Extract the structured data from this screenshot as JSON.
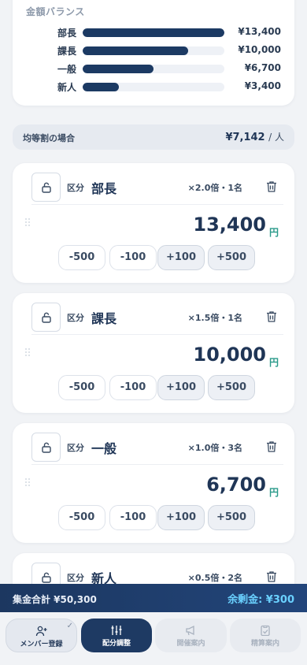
{
  "balance": {
    "title": "金額バランス",
    "rows": [
      {
        "label": "部長",
        "value": "¥13,400",
        "ratio": 1.0
      },
      {
        "label": "課長",
        "value": "¥10,000",
        "ratio": 0.746
      },
      {
        "label": "一般",
        "value": "¥6,700",
        "ratio": 0.5
      },
      {
        "label": "新人",
        "value": "¥3,400",
        "ratio": 0.254
      }
    ]
  },
  "equal_split": {
    "label": "均等割の場合",
    "value": "¥7,142",
    "unit": "/ 人"
  },
  "members": [
    {
      "kubun": "区分",
      "name": "部長",
      "multiplier": "×2.0倍・1名",
      "amount": "13,400",
      "currency": "円",
      "buttons": [
        "-500",
        "-100",
        "+100",
        "+500"
      ]
    },
    {
      "kubun": "区分",
      "name": "課長",
      "multiplier": "×1.5倍・1名",
      "amount": "10,000",
      "currency": "円",
      "buttons": [
        "-500",
        "-100",
        "+100",
        "+500"
      ]
    },
    {
      "kubun": "区分",
      "name": "一般",
      "multiplier": "×1.0倍・3名",
      "amount": "6,700",
      "currency": "円",
      "buttons": [
        "-500",
        "-100",
        "+100",
        "+500"
      ]
    },
    {
      "kubun": "区分",
      "name": "新人",
      "multiplier": "×0.5倍・2名",
      "amount": "",
      "currency": "",
      "buttons": []
    }
  ],
  "footer": {
    "total": "集金合計 ¥50,300",
    "remainder": "余剰金: ¥300"
  },
  "nav": [
    {
      "label": "メンバー登録",
      "icon": "user-plus-icon",
      "state": "done"
    },
    {
      "label": "配分調整",
      "icon": "sliders-icon",
      "state": "active"
    },
    {
      "label": "開催案内",
      "icon": "megaphone-icon",
      "state": "disabled"
    },
    {
      "label": "精算案内",
      "icon": "clipboard-check-icon",
      "state": "disabled"
    }
  ],
  "colors": {
    "primary": "#1c3a63",
    "accent_yen": "#2a9a8a",
    "remainder": "#6ad1ff",
    "background": "#f1f3f6"
  }
}
